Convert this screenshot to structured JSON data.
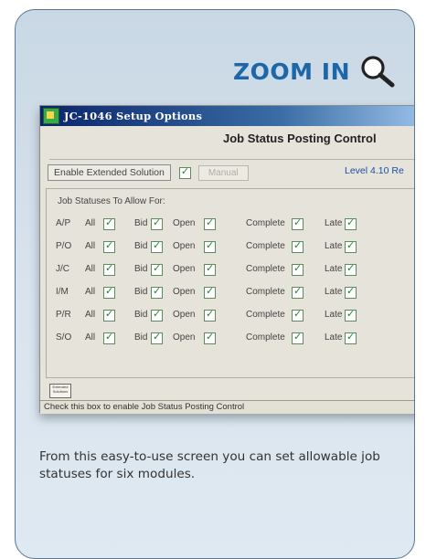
{
  "zoom_label": "ZOOM IN",
  "window": {
    "title": "JC-1046 Setup Options",
    "heading": "Job Status Posting Control",
    "enable_label": "Enable Extended Solution",
    "enable_checked": true,
    "manual_label": "Manual",
    "level_label": "Level 4.10   Re",
    "group_label": "Job Statuses To Allow For:",
    "column_labels": {
      "all": "All",
      "bid": "Bid",
      "open": "Open",
      "complete": "Complete",
      "late": "Late"
    },
    "modules": [
      {
        "code": "A/P"
      },
      {
        "code": "P/O"
      },
      {
        "code": "J/C"
      },
      {
        "code": "I/M"
      },
      {
        "code": "P/R"
      },
      {
        "code": "S/O"
      }
    ],
    "logo_text": "Extended Solutions",
    "status_text": "Check this box to enable Job Status Posting Control"
  },
  "caption": "From this easy-to-use screen you can set allowable job statuses for six modules.",
  "colors": {
    "accent": "#1d67a9",
    "card_border": "#5a7692",
    "check_green": "#1c8a2a"
  }
}
